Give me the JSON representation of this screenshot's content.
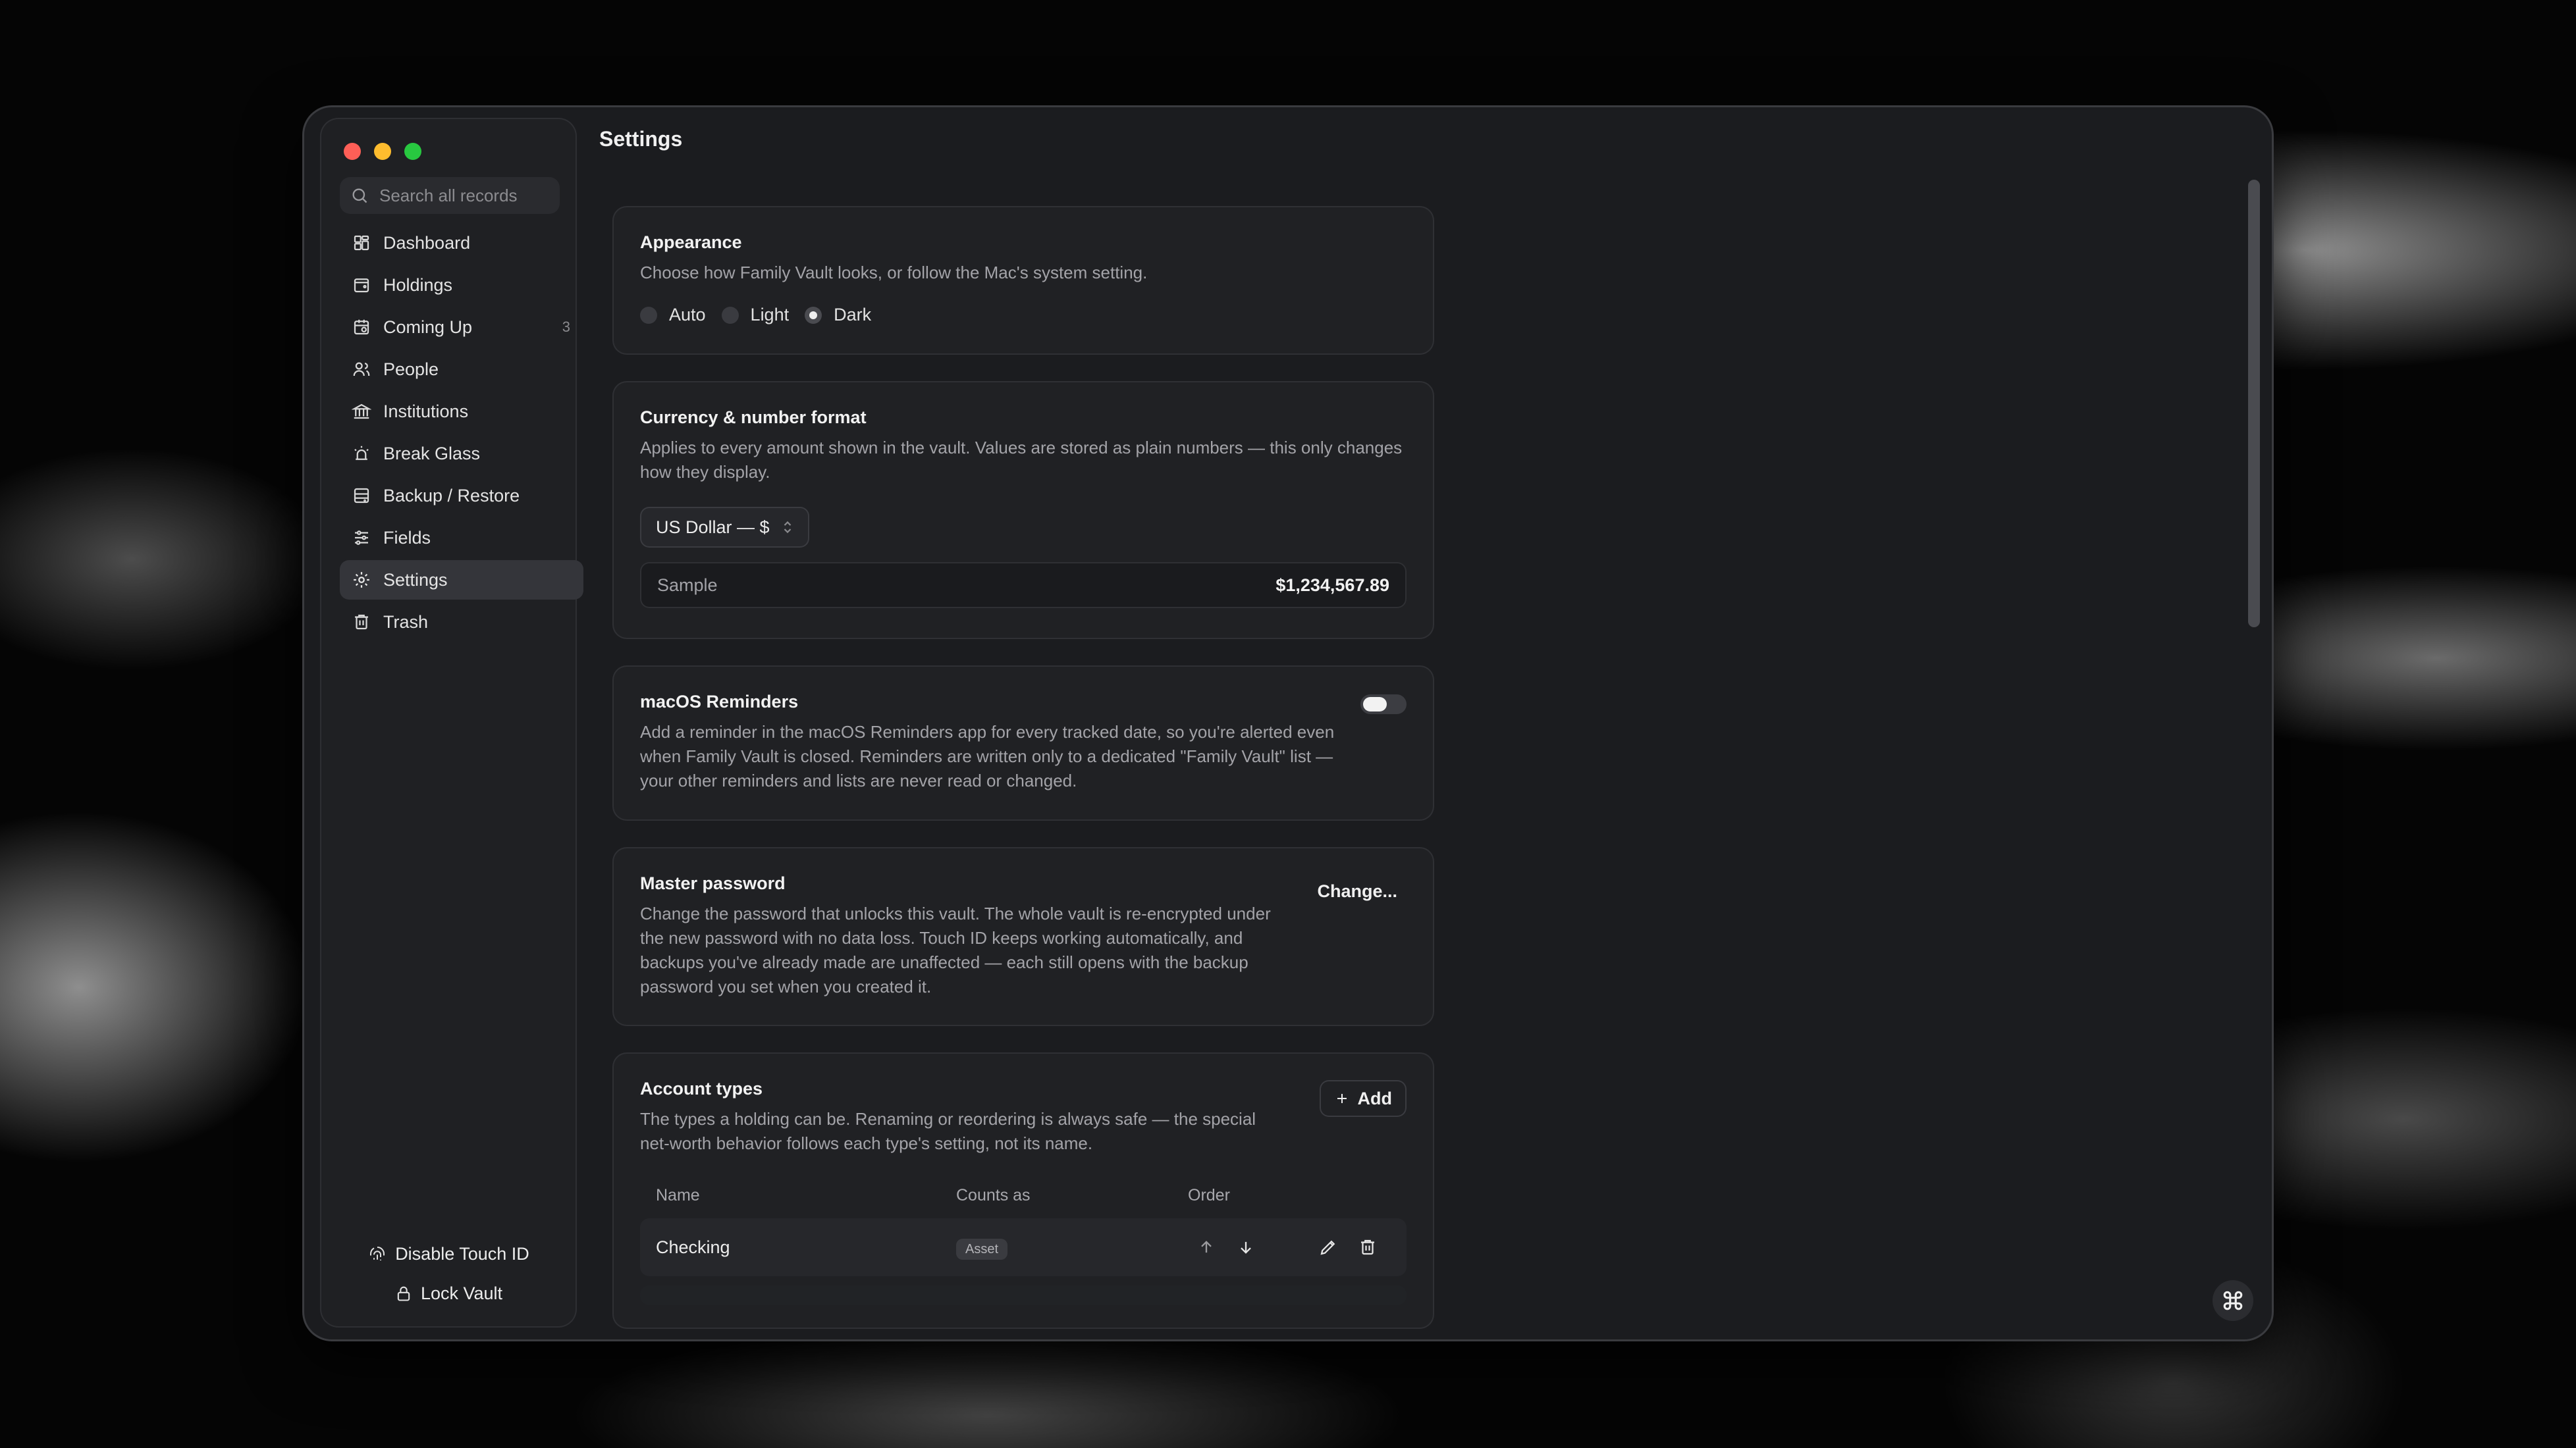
{
  "window": {
    "title": "Settings"
  },
  "search": {
    "placeholder": "Search all records"
  },
  "sidebar": {
    "items": [
      {
        "label": "Dashboard",
        "icon": "dashboard-icon"
      },
      {
        "label": "Holdings",
        "icon": "wallet-icon"
      },
      {
        "label": "Coming Up",
        "icon": "calendar-icon",
        "badge": "3"
      },
      {
        "label": "People",
        "icon": "people-icon"
      },
      {
        "label": "Institutions",
        "icon": "bank-icon"
      },
      {
        "label": "Break Glass",
        "icon": "alarm-icon"
      },
      {
        "label": "Backup / Restore",
        "icon": "database-icon"
      },
      {
        "label": "Fields",
        "icon": "sliders-icon"
      },
      {
        "label": "Settings",
        "icon": "gear-icon",
        "active": true
      },
      {
        "label": "Trash",
        "icon": "trash-icon"
      }
    ],
    "footer": {
      "touch_id": "Disable Touch ID",
      "lock": "Lock Vault"
    }
  },
  "appearance": {
    "title": "Appearance",
    "description": "Choose how Family Vault looks, or follow the Mac's system setting.",
    "options": [
      "Auto",
      "Light",
      "Dark"
    ],
    "selected": "Dark"
  },
  "currency": {
    "title": "Currency & number format",
    "description": "Applies to every amount shown in the vault. Values are stored as plain numbers — this only changes how they display.",
    "selected": "US Dollar — $",
    "sample_label": "Sample",
    "sample_value": "$1,234,567.89"
  },
  "reminders": {
    "title": "macOS Reminders",
    "description": "Add a reminder in the macOS Reminders app for every tracked date, so you're alerted even when Family Vault is closed. Reminders are written only to a dedicated \"Family Vault\" list — your other reminders and lists are never read or changed.",
    "enabled": false
  },
  "master_password": {
    "title": "Master password",
    "description": "Change the password that unlocks this vault. The whole vault is re-encrypted under the new password with no data loss. Touch ID keeps working automatically, and backups you've already made are unaffected — each still opens with the backup password you set when you created it.",
    "button": "Change..."
  },
  "account_types": {
    "title": "Account types",
    "description": "The types a holding can be. Renaming or reordering is always safe — the special net-worth behavior follows each type's setting, not its name.",
    "add_label": "Add",
    "columns": [
      "Name",
      "Counts as",
      "Order"
    ],
    "rows": [
      {
        "name": "Checking",
        "counts_as": "Asset"
      }
    ]
  },
  "colors": {
    "window_bg": "#1b1c1f",
    "card_bg": "#202124",
    "accent_text": "#f2f2f2",
    "muted_text": "#a3a3a8"
  }
}
